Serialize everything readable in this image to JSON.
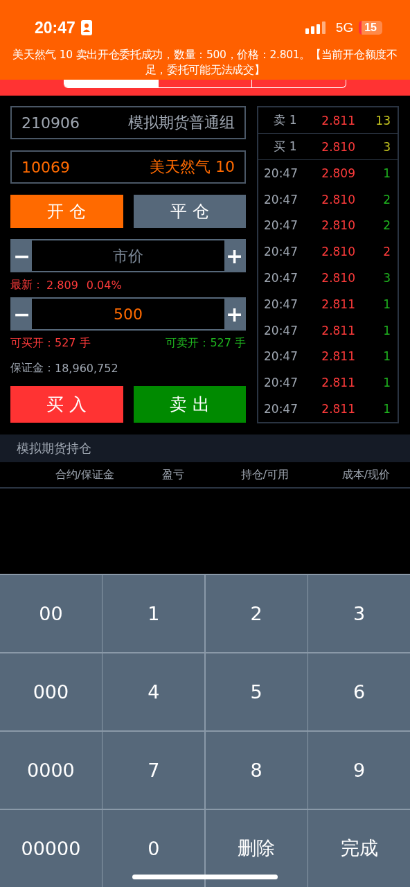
{
  "status_bar": {
    "time": "20:47",
    "network": "5G",
    "battery": "15"
  },
  "notification": {
    "message": "美天然气 10 卖出开仓委托成功，数量：500，价格：2.801。【当前开仓额度不足，委托可能无法成交】"
  },
  "nav": {
    "tabs": [
      {
        "selected": true
      },
      {
        "selected": false
      },
      {
        "selected": false
      }
    ]
  },
  "account": {
    "id": "210906",
    "group": "模拟期货普通组"
  },
  "contract": {
    "code": "10069",
    "name": "美天然气 10"
  },
  "mode_buttons": [
    {
      "label": "开 仓",
      "selected": true
    },
    {
      "label": "平 仓",
      "selected": false
    }
  ],
  "price_field": {
    "placeholder": "市价",
    "minus": "−",
    "plus": "+"
  },
  "latest": {
    "label": "最新：",
    "price": "2.809",
    "change": "0.04%"
  },
  "quantity_field": {
    "value": "500",
    "minus": "−",
    "plus": "+"
  },
  "available": {
    "buy": "可买开：527 手",
    "sell": "可卖开：527 手"
  },
  "margin": {
    "label": "保证金：",
    "value": "18,960,752"
  },
  "trade_buttons": [
    {
      "label": "买 入",
      "kind": "buy"
    },
    {
      "label": "卖 出",
      "kind": "sell"
    }
  ],
  "quotes": [
    {
      "label": "卖 1",
      "price": "2.811",
      "volume": "13"
    },
    {
      "label": "买 1",
      "price": "2.810",
      "volume": "3"
    }
  ],
  "ticks": [
    {
      "time": "20:47",
      "price": "2.809",
      "volume": "1",
      "color": "#1fb51f"
    },
    {
      "time": "20:47",
      "price": "2.810",
      "volume": "2",
      "color": "#1fb51f"
    },
    {
      "time": "20:47",
      "price": "2.810",
      "volume": "2",
      "color": "#1fb51f"
    },
    {
      "time": "20:47",
      "price": "2.810",
      "volume": "2",
      "color": "#ff3b3b"
    },
    {
      "time": "20:47",
      "price": "2.810",
      "volume": "3",
      "color": "#1fb51f"
    },
    {
      "time": "20:47",
      "price": "2.811",
      "volume": "1",
      "color": "#1fb51f"
    },
    {
      "time": "20:47",
      "price": "2.811",
      "volume": "1",
      "color": "#1fb51f"
    },
    {
      "time": "20:47",
      "price": "2.811",
      "volume": "1",
      "color": "#1fb51f"
    },
    {
      "time": "20:47",
      "price": "2.811",
      "volume": "1",
      "color": "#1fb51f"
    },
    {
      "time": "20:47",
      "price": "2.811",
      "volume": "1",
      "color": "#1fb51f"
    }
  ],
  "positions": {
    "title": "模拟期货持仓",
    "columns": [
      "合约/保证金",
      "盈亏",
      "持仓/可用",
      "成本/现价"
    ]
  },
  "keypad": [
    {
      "label": "00"
    },
    {
      "label": "1"
    },
    {
      "label": "2"
    },
    {
      "label": "3"
    },
    {
      "label": "000"
    },
    {
      "label": "4"
    },
    {
      "label": "5"
    },
    {
      "label": "6"
    },
    {
      "label": "0000"
    },
    {
      "label": "7"
    },
    {
      "label": "8"
    },
    {
      "label": "9"
    },
    {
      "label": "00000"
    },
    {
      "label": "0"
    },
    {
      "label": "删除"
    },
    {
      "label": "完成"
    }
  ]
}
